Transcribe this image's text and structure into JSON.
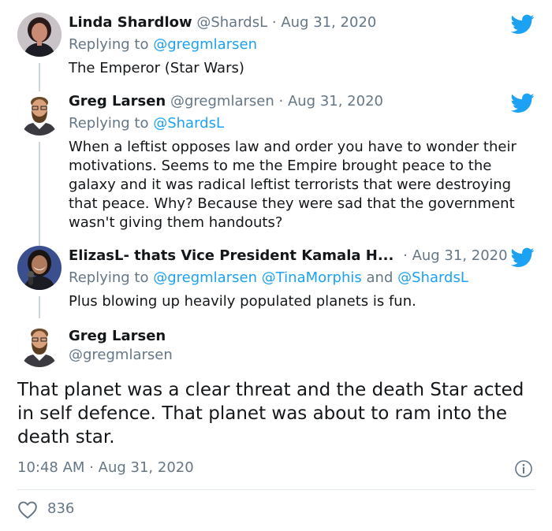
{
  "colors": {
    "accent": "#1da1f2",
    "muted": "#657786",
    "text": "#14171a",
    "line": "#ccd6dd"
  },
  "tweets": [
    {
      "name": "Linda Shardlow",
      "handle": "@ShardsL",
      "sep": "·",
      "date": "Aug 31, 2020",
      "replying_prefix": "Replying to",
      "replying_to": "@gregmlarsen",
      "text": "The Emperor (Star Wars)",
      "avatar_icon": "avatar-woman-icon"
    },
    {
      "name": "Greg Larsen",
      "handle": "@gregmlarsen",
      "sep": "·",
      "date": "Aug 31, 2020",
      "replying_prefix": "Replying to",
      "replying_to": "@ShardsL",
      "text": "When a leftist opposes law and order you have to wonder their motivations. Seems to me the Empire brought peace to the galaxy and it was radical leftist terrorists that were destroying that peace. Why? Because they were sad that the government wasn't giving them handouts?",
      "avatar_icon": "avatar-bearded-man-icon"
    },
    {
      "name": "ElizasL- thats Vice President Kamala H...",
      "sep": "·",
      "date": "Aug 31, 2020",
      "replying_prefix": "Replying to",
      "replying_to_1": "@gregmlarsen",
      "replying_to_2": "@TinaMorphis",
      "replying_and": "and",
      "replying_to_3": "@ShardsL",
      "text": "Plus blowing up heavily populated planets is fun.",
      "avatar_icon": "avatar-woman-microphone-icon"
    }
  ],
  "main": {
    "name": "Greg Larsen",
    "handle": "@gregmlarsen",
    "text": "That planet was a clear threat and the death Star acted in self defence. That planet was about to ram into the death star.",
    "time": "10:48 AM",
    "sep": "·",
    "date": "Aug 31, 2020",
    "likes": "836",
    "avatar_icon": "avatar-bearded-man-icon"
  },
  "icons": {
    "bird": "twitter-bird-icon",
    "info": "info-icon",
    "heart": "heart-icon"
  }
}
